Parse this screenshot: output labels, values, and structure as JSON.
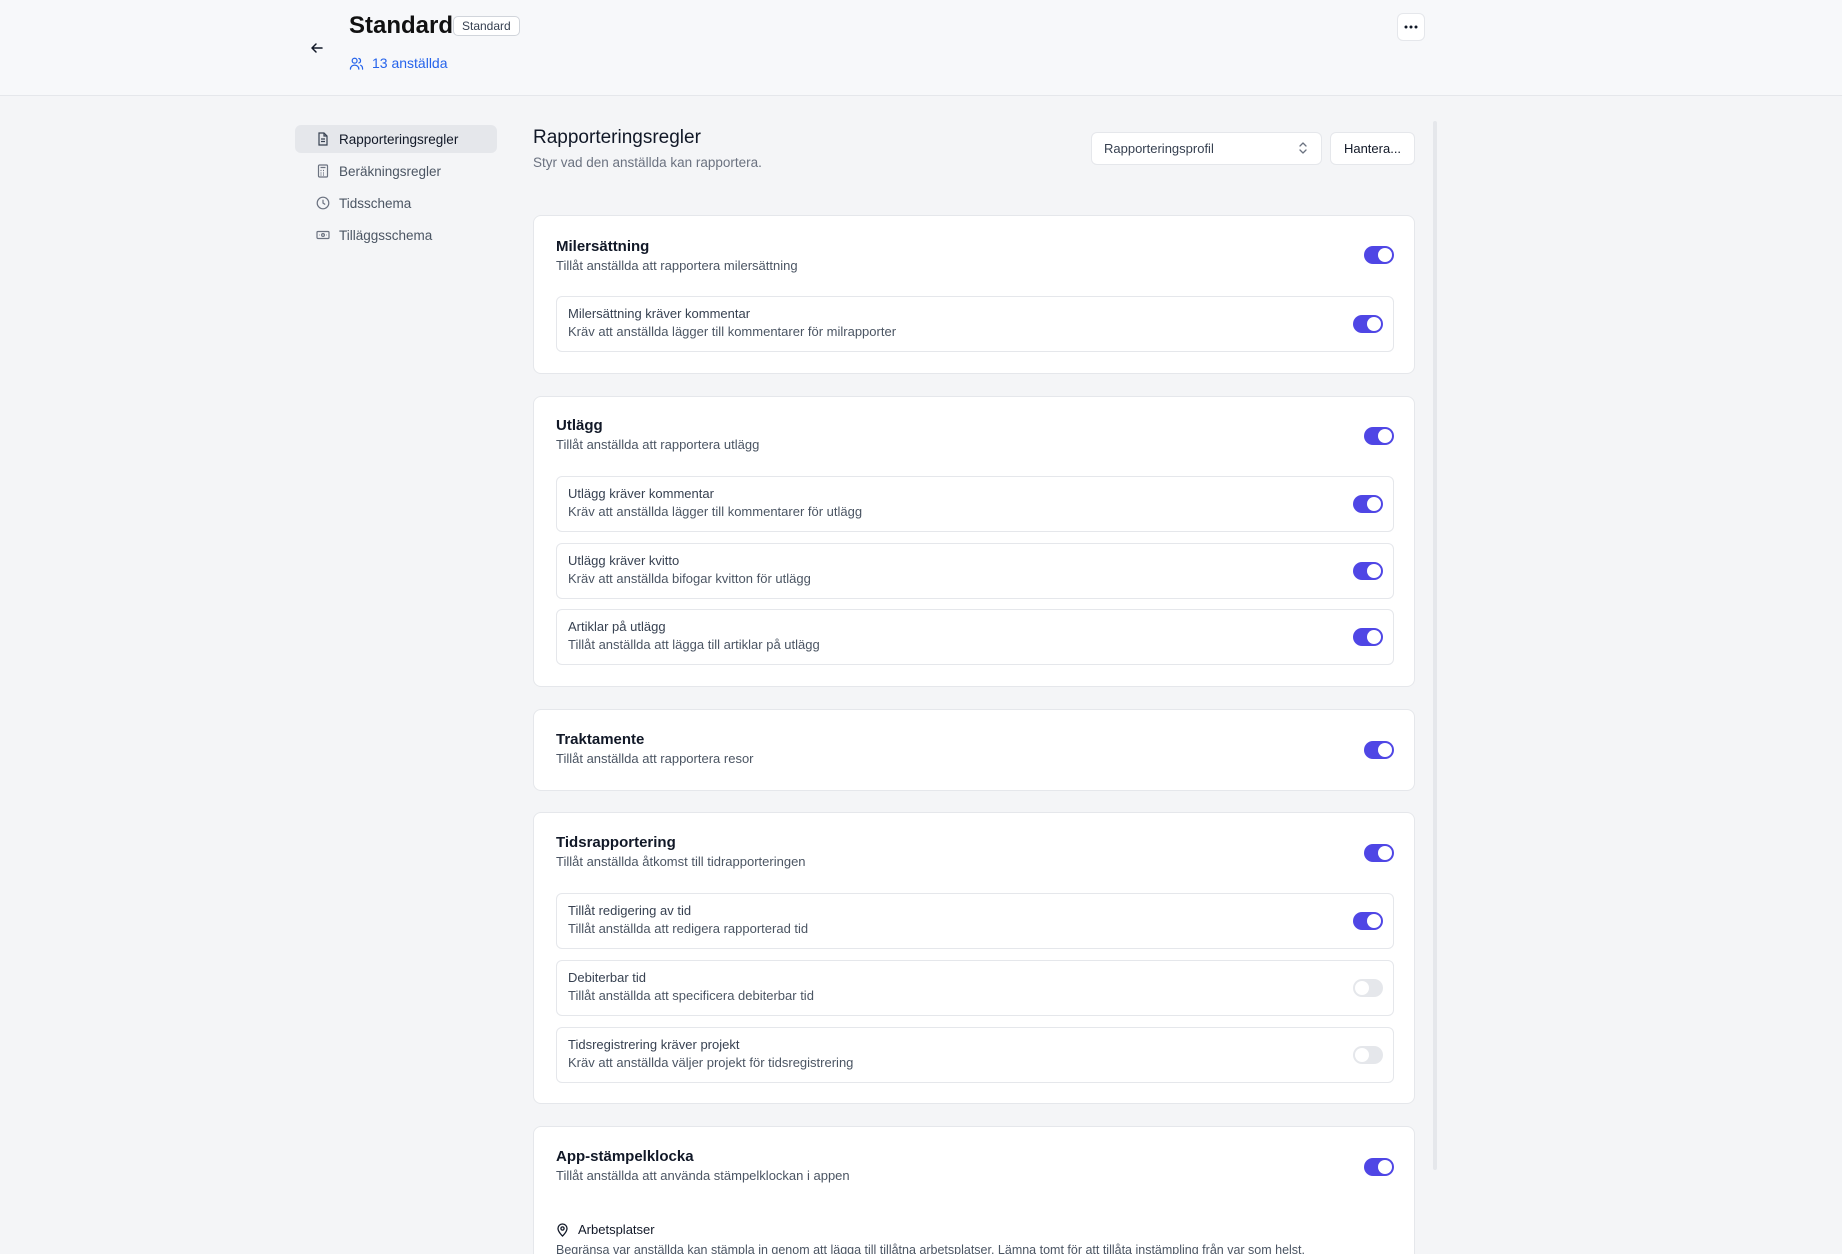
{
  "header": {
    "title": "Standard",
    "badge": "Standard",
    "employees": "13 anställda"
  },
  "sidebar": {
    "items": [
      {
        "label": "Rapporteringsregler",
        "icon": "document-icon",
        "active": true
      },
      {
        "label": "Beräkningsregler",
        "icon": "calculator-icon",
        "active": false
      },
      {
        "label": "Tidsschema",
        "icon": "clock-icon",
        "active": false
      },
      {
        "label": "Tilläggsschema",
        "icon": "ticket-icon",
        "active": false
      }
    ]
  },
  "main": {
    "title": "Rapporteringsregler",
    "subtitle": "Styr vad den anställda kan rapportera.",
    "profile_select": "Rapporteringsprofil",
    "manage_label": "Hantera..."
  },
  "sections": [
    {
      "title": "Milersättning",
      "desc": "Tillåt anställda att rapportera milersättning",
      "enabled": true,
      "subs": [
        {
          "title": "Milersättning kräver kommentar",
          "desc": "Kräv att anställda lägger till kommentarer för milrapporter",
          "enabled": true
        }
      ]
    },
    {
      "title": "Utlägg",
      "desc": "Tillåt anställda att rapportera utlägg",
      "enabled": true,
      "subs": [
        {
          "title": "Utlägg kräver kommentar",
          "desc": "Kräv att anställda lägger till kommentarer för utlägg",
          "enabled": true
        },
        {
          "title": "Utlägg kräver kvitto",
          "desc": "Kräv att anställda bifogar kvitton för utlägg",
          "enabled": true
        },
        {
          "title": "Artiklar på utlägg",
          "desc": "Tillåt anställda att lägga till artiklar på utlägg",
          "enabled": true
        }
      ]
    },
    {
      "title": "Traktamente",
      "desc": "Tillåt anställda att rapportera resor",
      "enabled": true,
      "subs": []
    },
    {
      "title": "Tidsrapportering",
      "desc": "Tillåt anställda åtkomst till tidrapporteringen",
      "enabled": true,
      "subs": [
        {
          "title": "Tillåt redigering av tid",
          "desc": "Tillåt anställda att redigera rapporterad tid",
          "enabled": true
        },
        {
          "title": "Debiterbar tid",
          "desc": "Tillåt anställda att specificera debiterbar tid",
          "enabled": false
        },
        {
          "title": "Tidsregistrering kräver projekt",
          "desc": "Kräv att anställda väljer projekt för tidsregistrering",
          "enabled": false
        }
      ]
    },
    {
      "title": "App-stämpelklocka",
      "desc": "Tillåt anställda att använda stämpelklockan i appen",
      "enabled": true,
      "subs": [],
      "locations": {
        "title": "Arbetsplatser",
        "desc": "Begränsa var anställda kan stämpla in genom att lägga till tillåtna arbetsplatser. Lämna tomt för att tillåta instämpling från var som helst."
      }
    }
  ],
  "colors": {
    "accent": "#4f46e5",
    "link": "#2563eb",
    "toggle_off": "#e5e7eb"
  }
}
